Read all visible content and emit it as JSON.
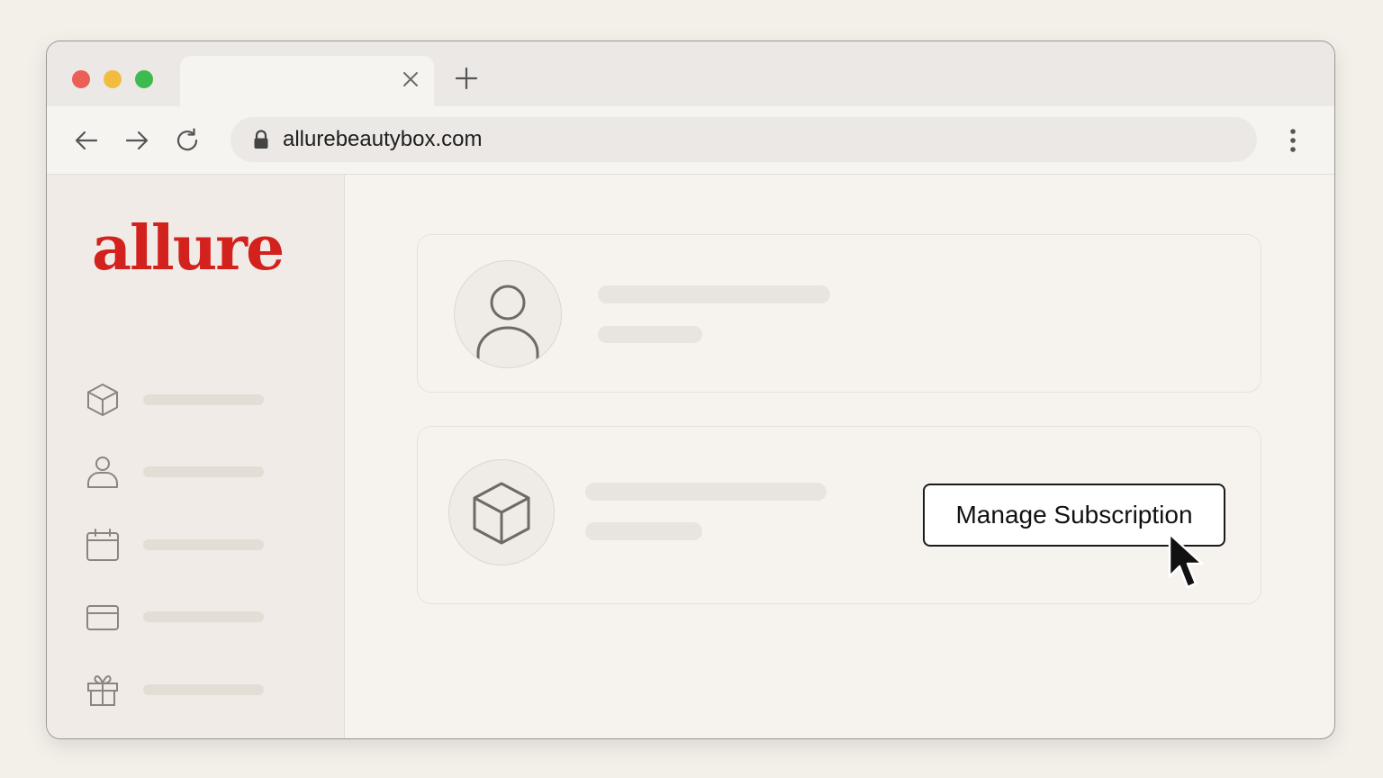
{
  "browser": {
    "url": "allurebeautybox.com",
    "tab_title": "",
    "controls": {
      "back_icon": "arrow-left-icon",
      "forward_icon": "arrow-right-icon",
      "reload_icon": "reload-icon",
      "menu_icon": "kebab-menu-icon",
      "new_tab_icon": "plus-icon",
      "close_tab_icon": "close-icon"
    }
  },
  "sidebar": {
    "logo": "allure",
    "logo_color": "#d3211d",
    "items": [
      {
        "icon": "box-icon"
      },
      {
        "icon": "user-icon"
      },
      {
        "icon": "calendar-icon"
      },
      {
        "icon": "credit-card-icon"
      },
      {
        "icon": "gift-icon"
      }
    ]
  },
  "main": {
    "profile_card": {
      "icon": "user-icon"
    },
    "subscription_card": {
      "icon": "box-icon",
      "button_label": "Manage Subscription"
    }
  }
}
